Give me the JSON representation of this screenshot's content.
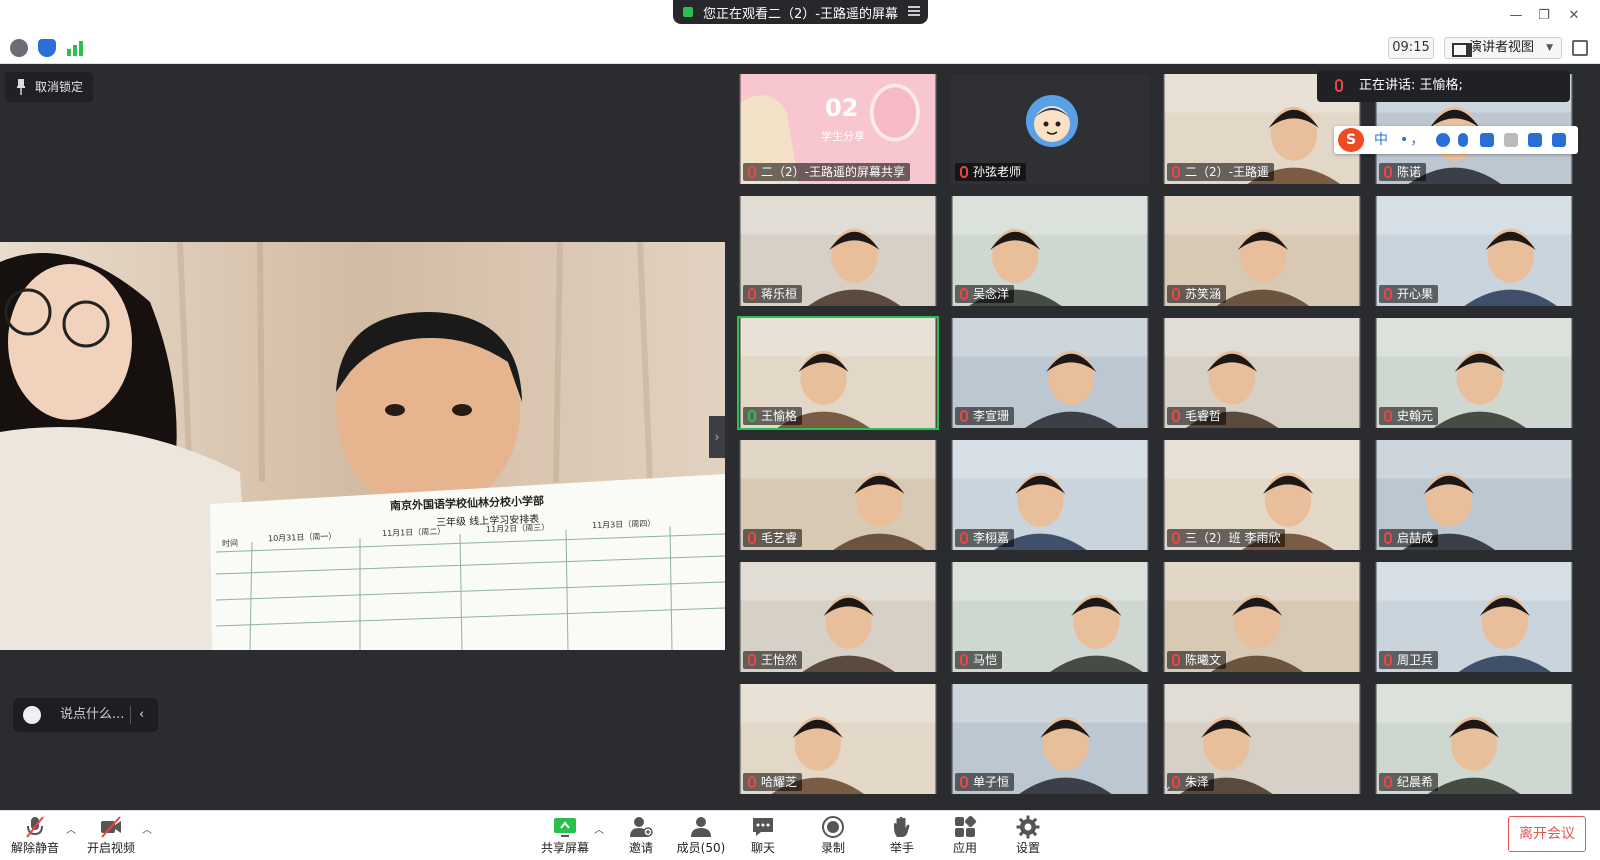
{
  "titlebar": {
    "share_notice": "您正在观看二（2）-王路遥的屏幕"
  },
  "toolbar": {
    "clock": "09:15",
    "view_mode": "演讲者视图"
  },
  "main": {
    "unlock_label": "取消锁定",
    "chat_placeholder": "说点什么...",
    "shared_doc": {
      "school": "南京外国语学校仙林分校小学部",
      "subtitle": "三年级 线上学习安排表",
      "headers": [
        "时间",
        "10月31日（周一）",
        "11月1日（周二）",
        "11月2日（周三）",
        "11月3日（周四）"
      ]
    }
  },
  "speaking": {
    "label": "正在讲话: 王愉格;"
  },
  "ime": {
    "s": "S",
    "mode": "中",
    "punct": "•，"
  },
  "gallery": {
    "tiles": [
      {
        "name": "二（2）-王路遥的屏幕共享",
        "type": "share",
        "title": "02",
        "subtitle": "学生分享"
      },
      {
        "name": "孙弦老师",
        "type": "avatar"
      },
      {
        "name": "二（2）-王路遥",
        "type": "video"
      },
      {
        "name": "陈诺",
        "type": "video"
      },
      {
        "name": "蒋乐桓",
        "type": "video"
      },
      {
        "name": "吴念洋",
        "type": "video"
      },
      {
        "name": "苏笑涵",
        "type": "video"
      },
      {
        "name": "开心果",
        "type": "video"
      },
      {
        "name": "王愉格",
        "type": "video",
        "active": true
      },
      {
        "name": "李宣珊",
        "type": "video"
      },
      {
        "name": "毛睿哲",
        "type": "video"
      },
      {
        "name": "史翰元",
        "type": "video"
      },
      {
        "name": "毛艺睿",
        "type": "video"
      },
      {
        "name": "李栩嘉",
        "type": "video"
      },
      {
        "name": "三（2）班 李雨欣",
        "type": "video"
      },
      {
        "name": "启喆成",
        "type": "video"
      },
      {
        "name": "王怡然",
        "type": "video"
      },
      {
        "name": "马恺",
        "type": "video"
      },
      {
        "name": "陈曦文",
        "type": "video"
      },
      {
        "name": "周卫兵",
        "type": "video"
      },
      {
        "name": "哈耀芝",
        "type": "video"
      },
      {
        "name": "单子恒",
        "type": "video"
      },
      {
        "name": "朱泽",
        "type": "video"
      },
      {
        "name": "纪晨希",
        "type": "video"
      }
    ]
  },
  "bottombar": {
    "unmute": "解除静音",
    "start_video": "开启视频",
    "share_screen": "共享屏幕",
    "invite": "邀请",
    "members": "成员(50)",
    "chat": "聊天",
    "record": "录制",
    "raise_hand": "举手",
    "apps": "应用",
    "settings": "设置",
    "leave": "离开会议"
  },
  "colors": {
    "accent_green": "#2bbf4e",
    "mute_red": "#e44444",
    "leave_red": "#e45757",
    "background": "#2b2c30"
  }
}
